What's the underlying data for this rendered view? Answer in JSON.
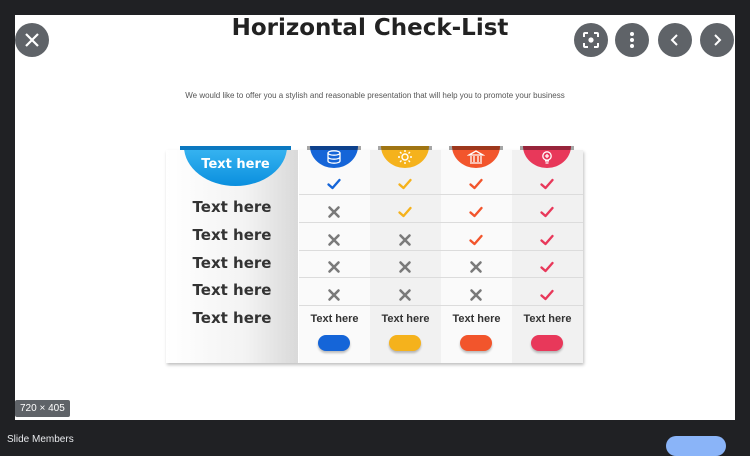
{
  "viewer": {
    "size_badge": "720 × 405",
    "caption": "Slide Members",
    "close_icon": "close-icon",
    "lens_icon": "lens-search-icon",
    "more_icon": "more-vert-icon",
    "prev_icon": "chevron-left-icon",
    "next_icon": "chevron-right-icon"
  },
  "slide": {
    "title": "Horizontal Check-List",
    "subtitle": "We would like to offer you a stylish and reasonable presentation that will help you to promote your business",
    "header_label": "Text here",
    "row_labels": [
      "Text here",
      "Text here",
      "Text here",
      "Text here",
      "Text here"
    ],
    "columns": [
      {
        "icon": "database-icon",
        "color": "#1565d8",
        "footer": "Text here",
        "marks": [
          "check",
          "cross",
          "cross",
          "cross",
          "cross"
        ]
      },
      {
        "icon": "gear-icon",
        "color": "#f5b21c",
        "footer": "Text here",
        "marks": [
          "check",
          "check",
          "cross",
          "cross",
          "cross"
        ]
      },
      {
        "icon": "bank-icon",
        "color": "#f2552c",
        "footer": "Text here",
        "marks": [
          "check",
          "check",
          "check",
          "cross",
          "cross"
        ]
      },
      {
        "icon": "idea-icon",
        "color": "#e8385a",
        "footer": "Text here",
        "marks": [
          "check",
          "check",
          "check",
          "check",
          "check"
        ]
      }
    ]
  }
}
